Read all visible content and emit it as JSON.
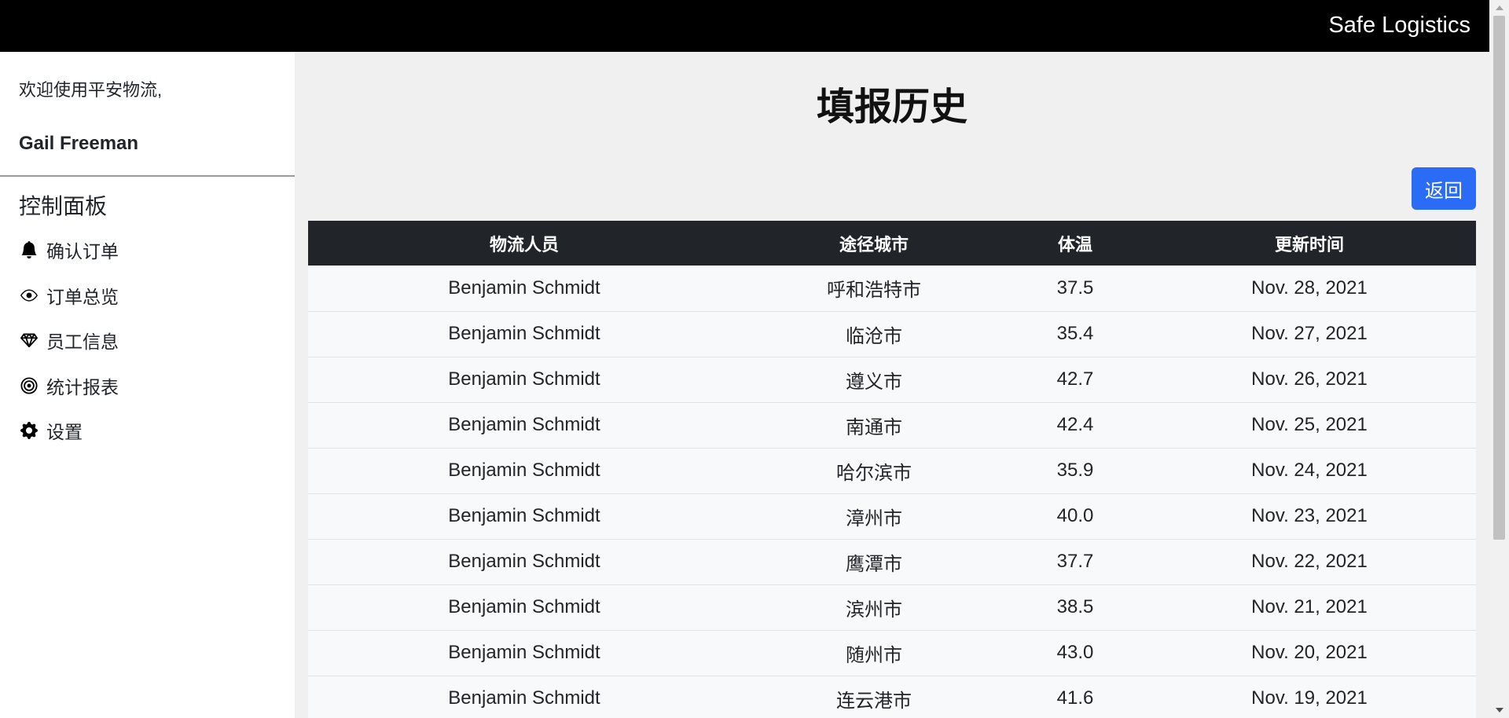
{
  "header": {
    "brand": "Safe Logistics"
  },
  "sidebar": {
    "welcome": "欢迎使用平安物流,",
    "username": "Gail Freeman",
    "heading": "控制面板",
    "items": [
      {
        "label": "确认订单",
        "icon": "bell-icon"
      },
      {
        "label": "订单总览",
        "icon": "eye-icon"
      },
      {
        "label": "员工信息",
        "icon": "gem-icon"
      },
      {
        "label": "统计报表",
        "icon": "bullseye-icon"
      },
      {
        "label": "设置",
        "icon": "gear-icon"
      }
    ]
  },
  "main": {
    "title": "填报历史",
    "back_label": "返回",
    "columns": [
      "物流人员",
      "途径城市",
      "体温",
      "更新时间"
    ],
    "rows": [
      [
        "Benjamin Schmidt",
        "呼和浩特市",
        "37.5",
        "Nov. 28, 2021"
      ],
      [
        "Benjamin Schmidt",
        "临沧市",
        "35.4",
        "Nov. 27, 2021"
      ],
      [
        "Benjamin Schmidt",
        "遵义市",
        "42.7",
        "Nov. 26, 2021"
      ],
      [
        "Benjamin Schmidt",
        "南通市",
        "42.4",
        "Nov. 25, 2021"
      ],
      [
        "Benjamin Schmidt",
        "哈尔滨市",
        "35.9",
        "Nov. 24, 2021"
      ],
      [
        "Benjamin Schmidt",
        "漳州市",
        "40.0",
        "Nov. 23, 2021"
      ],
      [
        "Benjamin Schmidt",
        "鹰潭市",
        "37.7",
        "Nov. 22, 2021"
      ],
      [
        "Benjamin Schmidt",
        "滨州市",
        "38.5",
        "Nov. 21, 2021"
      ],
      [
        "Benjamin Schmidt",
        "随州市",
        "43.0",
        "Nov. 20, 2021"
      ],
      [
        "Benjamin Schmidt",
        "连云港市",
        "41.6",
        "Nov. 19, 2021"
      ]
    ]
  },
  "colors": {
    "header_bg": "#000000",
    "table_header_bg": "#212529",
    "button_bg": "#2a6cf6",
    "main_bg": "#f0f0f0"
  }
}
